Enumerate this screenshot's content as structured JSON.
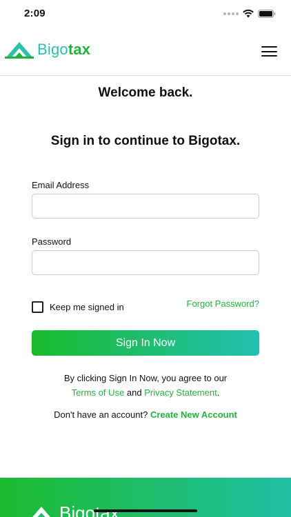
{
  "status_bar": {
    "time": "2:09"
  },
  "header": {
    "brand_part1": "Bigo",
    "brand_part2": "tax",
    "colors": {
      "brand_teal": "#2ebfae",
      "brand_green": "#23b33a"
    }
  },
  "main": {
    "welcome": "Welcome back.",
    "subtitle": "Sign in to continue to Bigotax.",
    "email_label": "Email Address",
    "email_value": "",
    "password_label": "Password",
    "password_value": "",
    "keep_signed_in": "Keep me signed in",
    "keep_signed_in_checked": false,
    "forgot_password": "Forgot Password?",
    "signin_button": "Sign In Now",
    "agree_prefix": "By clicking Sign In Now, you agree to our",
    "terms_link": "Terms of Use",
    "and_text": "and",
    "privacy_link": "Privacy Statement",
    "period": ".",
    "no_account": "Don't have an account?",
    "create_account": "Create New Account"
  },
  "footer": {
    "brand": "Bigotax"
  },
  "icons": [
    "wifi-icon",
    "battery-icon",
    "signal-dots-icon",
    "bigotax-logo-icon",
    "hamburger-menu-icon"
  ]
}
